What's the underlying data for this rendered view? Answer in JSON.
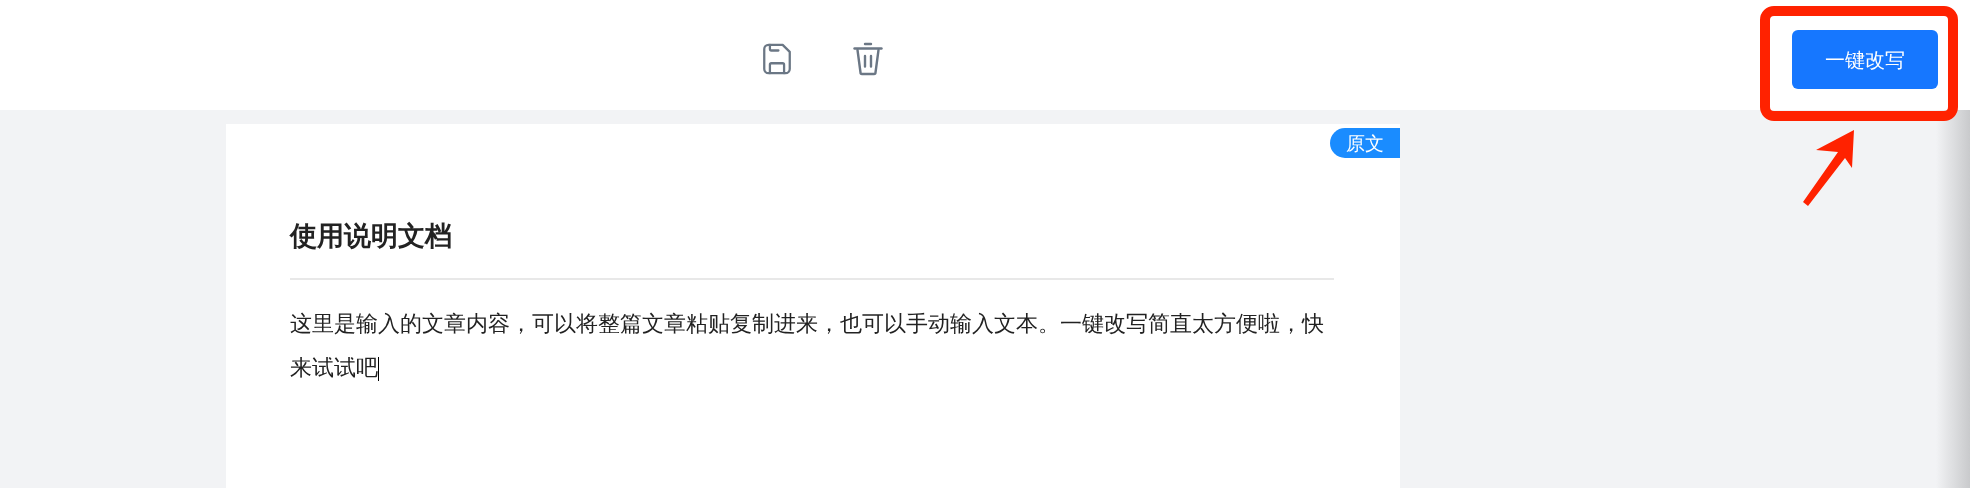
{
  "toolbar": {
    "rewrite_button": {
      "label": "一键改写"
    }
  },
  "document": {
    "badge": "原文",
    "title": "使用说明文档",
    "body": "这里是输入的文章内容，可以将整篇文章粘贴复制进来，也可以手动输入文本。一键改写简直太方便啦，快来试试吧"
  }
}
